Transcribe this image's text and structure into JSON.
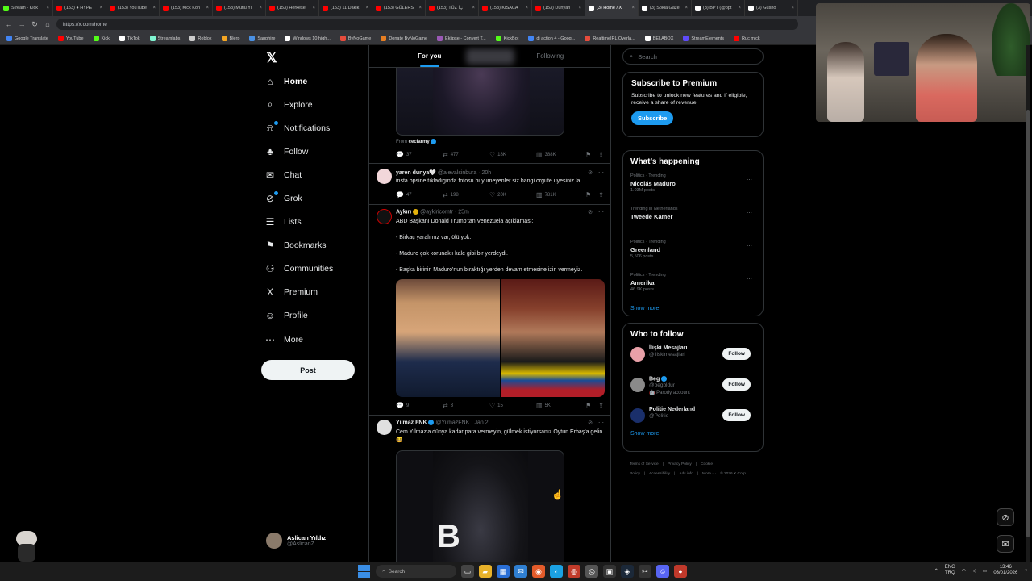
{
  "browser": {
    "tabs": [
      {
        "label": "Stream - Kick",
        "color": "#53fc18"
      },
      {
        "label": "(153) ● HYPE",
        "color": "#ff0000"
      },
      {
        "label": "(153) YouTube",
        "color": "#ff0000"
      },
      {
        "label": "(153) Kick Kon",
        "color": "#ff0000"
      },
      {
        "label": "(153) Mutlu Yi",
        "color": "#ff0000"
      },
      {
        "label": "(153) Herkese",
        "color": "#ff0000"
      },
      {
        "label": "(153) 11 Dakik",
        "color": "#ff0000"
      },
      {
        "label": "(153) GÜLERS",
        "color": "#ff0000"
      },
      {
        "label": "(153) TÜZ İÇ",
        "color": "#ff0000"
      },
      {
        "label": "(153) KISACA",
        "color": "#ff0000"
      },
      {
        "label": "(153) Dünyan",
        "color": "#ff0000"
      },
      {
        "label": "(3) Home / X",
        "color": "#ffffff",
        "active": true
      },
      {
        "label": "(3) Sokia Gaze",
        "color": "#ffffff"
      },
      {
        "label": "(3) BPT (@bpt",
        "color": "#ffffff"
      },
      {
        "label": "(3) Gusho",
        "color": "#ffffff"
      }
    ],
    "url": "https://x.com/home",
    "bookmarks": [
      {
        "label": "Google Translate",
        "color": "#4285f4"
      },
      {
        "label": "YouTube",
        "color": "#ff0000"
      },
      {
        "label": "Kick",
        "color": "#53fc18"
      },
      {
        "label": "TikTok",
        "color": "#ffffff"
      },
      {
        "label": "Streamlabs",
        "color": "#80f5d2"
      },
      {
        "label": "Roblox",
        "color": "#cccccc"
      },
      {
        "label": "Blerp",
        "color": "#f5a623"
      },
      {
        "label": "Sapphire",
        "color": "#4a90e2"
      },
      {
        "label": "Windows 10 high...",
        "color": "#ffffff"
      },
      {
        "label": "ByNoGame",
        "color": "#e74c3c"
      },
      {
        "label": "Donate ByNoGame",
        "color": "#e67e22"
      },
      {
        "label": "Eklipse - Convert T...",
        "color": "#9b59b6"
      },
      {
        "label": "KickBot",
        "color": "#53fc18"
      },
      {
        "label": "dj action 4 - Goog...",
        "color": "#4285f4"
      },
      {
        "label": "RealtimeIRL Overla...",
        "color": "#e74c3c"
      },
      {
        "label": "BELABOX",
        "color": "#ffffff"
      },
      {
        "label": "StreamElements",
        "color": "#5f4bfa"
      },
      {
        "label": "Ruç mick",
        "color": "#ff0000"
      }
    ]
  },
  "nav": {
    "items": [
      {
        "label": "Home",
        "icon": "⌂",
        "active": true
      },
      {
        "label": "Explore",
        "icon": "⌕"
      },
      {
        "label": "Notifications",
        "icon": "⍾",
        "dot": true
      },
      {
        "label": "Follow",
        "icon": "♣"
      },
      {
        "label": "Chat",
        "icon": "✉"
      },
      {
        "label": "Grok",
        "icon": "⊘",
        "dot": true
      },
      {
        "label": "Lists",
        "icon": "☰"
      },
      {
        "label": "Bookmarks",
        "icon": "⚑"
      },
      {
        "label": "Communities",
        "icon": "⚇"
      },
      {
        "label": "Premium",
        "icon": "X"
      },
      {
        "label": "Profile",
        "icon": "☺"
      },
      {
        "label": "More",
        "icon": "⋯"
      }
    ],
    "post_label": "Post",
    "account": {
      "name": "Aslican Yıldız",
      "handle": "@AslicanZ"
    }
  },
  "feed": {
    "tabs": [
      "For you",
      "Following"
    ],
    "tweet0": {
      "from_prefix": "From ",
      "from_name": "cecIarmy",
      "counts": [
        "37",
        "477",
        "18K",
        "388K"
      ]
    },
    "tweet1": {
      "name": "yaren dunya🤍",
      "meta": "@alevalsinbura · 20h",
      "text": "insta ppsine tıkladıgında fotosu buyumeyenler siz hangi orgute uyesiniz la",
      "counts": [
        "47",
        "198",
        "20K",
        "781K"
      ]
    },
    "tweet2": {
      "name": "Aykırı",
      "meta": "@aykiricomtr · 25m",
      "lines": [
        "ABD Başkanı Donald Trump'tan Venezuela açıklaması:",
        "- Birkaç yaralımız var, ölü yok.",
        "- Maduro çok korunaklı kale gibi bir yerdeydi.",
        "- Başka birinin Maduro'nun bıraktığı yerden devam etmesine izin vermeyiz."
      ],
      "counts": [
        "9",
        "3",
        "15",
        "5K"
      ]
    },
    "tweet3": {
      "name": "Yılmaz FNK",
      "meta": "@YilmazFNK · Jan 2",
      "text": "Cem Yılmaz'a dünya kadar para vermeyin, gülmek istiyorsanız Oytun Erbaş'a gelin 😆",
      "media_text": "B"
    }
  },
  "sidebar": {
    "search_placeholder": "Search",
    "premium": {
      "title": "Subscribe to Premium",
      "text": "Subscribe to unlock new features and if eligible, receive a share of revenue.",
      "button": "Subscribe"
    },
    "happening": {
      "title": "What’s happening",
      "trends": [
        {
          "category": "Politics · Trending",
          "name": "Nicolás Maduro",
          "count": "1.03M posts"
        },
        {
          "category": "Trending in Netherlands",
          "name": "Tweede Kamer",
          "count": ""
        },
        {
          "category": "Politics · Trending",
          "name": "Greenland",
          "count": "5,506 posts"
        },
        {
          "category": "Politics · Trending",
          "name": "Amerika",
          "count": "46.9K posts"
        }
      ],
      "show_more": "Show more"
    },
    "who_to_follow": {
      "title": "Who to follow",
      "users": [
        {
          "name": "İlişki Mesajları",
          "handle": "@iliskimesajlari",
          "extra": "",
          "verified": false,
          "color": "#e8a0a8"
        },
        {
          "name": "Beg",
          "handle": "@begbldur",
          "extra": "🤖 Parody account",
          "verified": true,
          "color": "#8a8a8a"
        },
        {
          "name": "Politie Nederland",
          "handle": "@Politie",
          "extra": "",
          "verified": false,
          "color": "#1a2f6b"
        }
      ],
      "follow_label": "Follow",
      "show_more": "Show more"
    },
    "footer": [
      "Terms of Service",
      "|",
      "Privacy Policy",
      "|",
      "Cookie Policy",
      "|",
      "Accessibility",
      "|",
      "Ads info",
      "|",
      "More ···",
      "© 2026 X Corp."
    ]
  },
  "taskbar": {
    "search": "Search",
    "lang_top": "ENG",
    "lang_bottom": "TRQ",
    "time": "13:46",
    "date": "03/01/2026"
  }
}
